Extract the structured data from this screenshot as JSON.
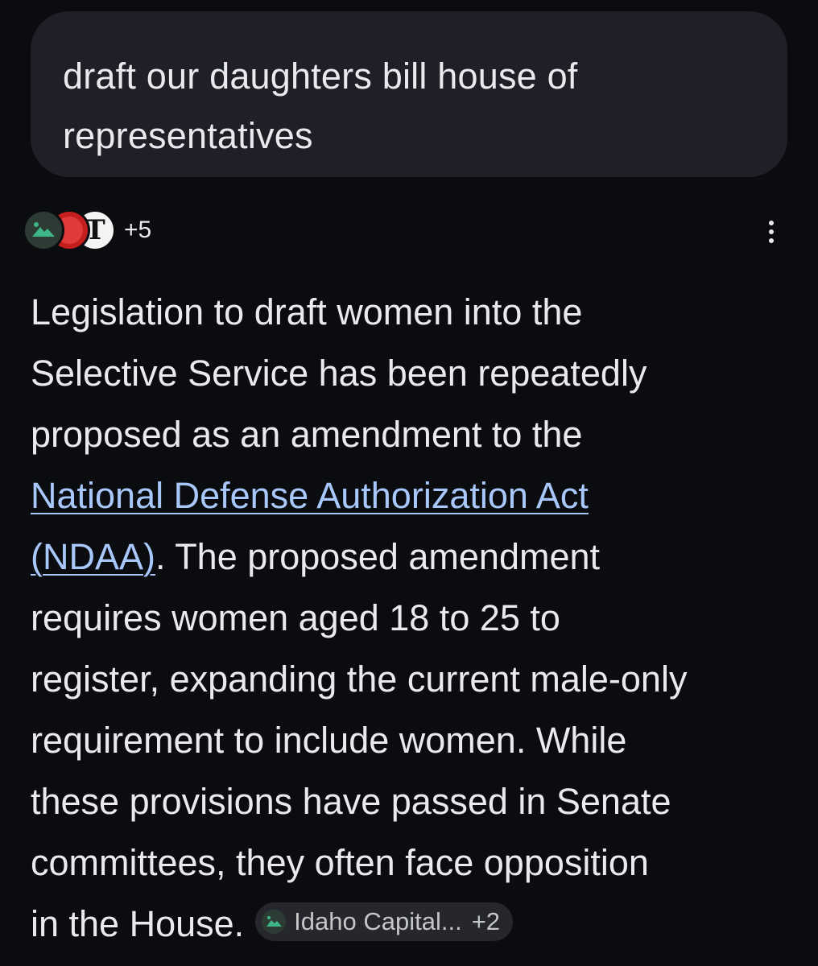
{
  "query": {
    "lines": [
      "draft our daughters bill house of",
      "representatives"
    ]
  },
  "sources": {
    "icons": [
      "mountain-icon",
      "red-publisher-icon",
      "nyt-logo-icon"
    ],
    "nyt_glyph": "T",
    "more_count": "+5"
  },
  "answer": {
    "line1": "Legislation to draft women into the",
    "line2": "Selective Service has been repeatedly",
    "line3": "proposed as an amendment to the",
    "link_part1": "National Defense Authorization Act",
    "link_part2": "(NDAA)",
    "line5_rest": ". The proposed amendment",
    "line6": "requires women aged 18 to 25 to",
    "line7": "register, expanding the current male-only",
    "line8": "requirement to include women. While",
    "line9": "these provisions have passed in Senate",
    "line10": "committees, they often face opposition",
    "line11": "in the House."
  },
  "citation": {
    "label": "Idaho Capital...",
    "extra": "+2"
  },
  "colors": {
    "background": "#0b0c10",
    "bubble": "#1f2027",
    "text": "#e8eaed",
    "link": "#a8c7fa",
    "chip": "#26272d"
  }
}
